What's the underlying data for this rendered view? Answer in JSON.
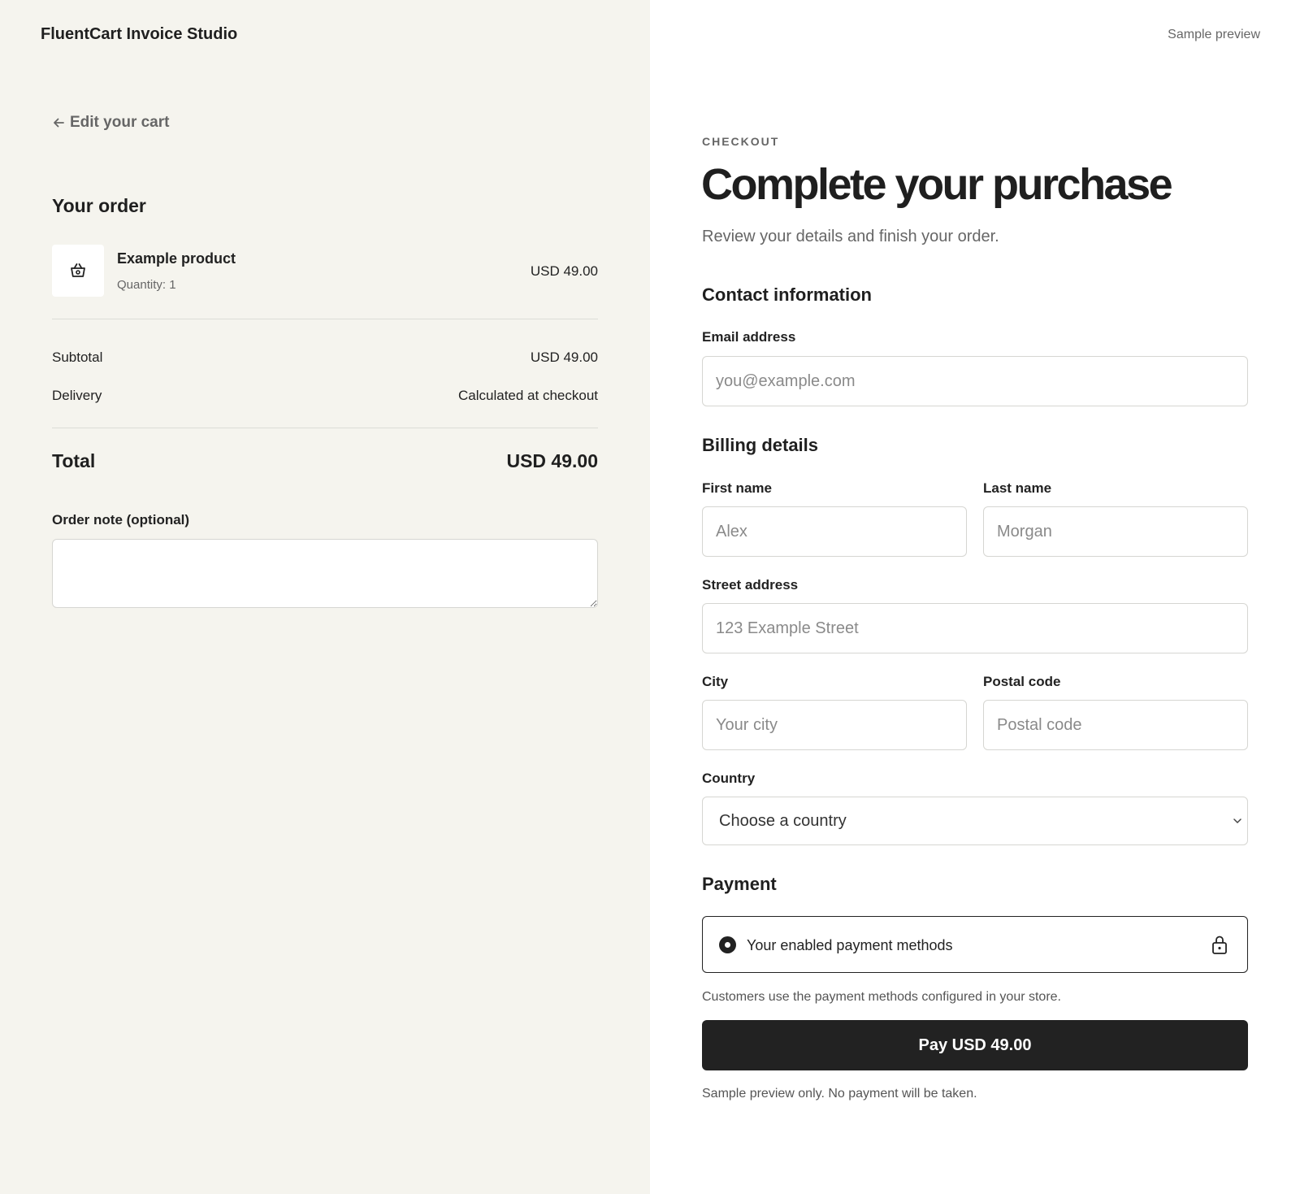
{
  "app": {
    "brand": "FluentCart Invoice Studio",
    "preview_label": "Sample preview"
  },
  "cart": {
    "back_link": "Edit your cart",
    "title": "Your order",
    "product": {
      "icon": "basket-icon",
      "name": "Example product",
      "quantity": "Quantity: 1",
      "price": "USD 49.00"
    },
    "subtotal_label": "Subtotal",
    "subtotal_value": "USD 49.00",
    "delivery_label": "Delivery",
    "delivery_value": "Calculated at checkout",
    "total_label": "Total",
    "total_value": "USD 49.00",
    "note_label": "Order note (optional)",
    "note_value": ""
  },
  "checkout": {
    "eyebrow": "CHECKOUT",
    "title": "Complete your purchase",
    "subtitle": "Review your details and finish your order.",
    "contact": {
      "title": "Contact information",
      "email_label": "Email address",
      "email_placeholder": "you@example.com"
    },
    "billing": {
      "title": "Billing details",
      "first_name_label": "First name",
      "first_name_placeholder": "Alex",
      "last_name_label": "Last name",
      "last_name_placeholder": "Morgan",
      "street_label": "Street address",
      "street_placeholder": "123 Example Street",
      "city_label": "City",
      "city_placeholder": "Your city",
      "postal_label": "Postal code",
      "postal_placeholder": "Postal code",
      "country_label": "Country",
      "country_selected": "Choose a country"
    },
    "payment": {
      "title": "Payment",
      "method_label": "Your enabled payment methods",
      "help": "Customers use the payment methods configured in your store.",
      "button": "Pay USD 49.00",
      "footnote": "Sample preview only. No payment will be taken."
    }
  },
  "colors": {
    "left_bg": "#f5f4ee",
    "text": "#222222",
    "muted": "#666666",
    "button_bg": "#222222",
    "border": "#d6d6d2"
  }
}
